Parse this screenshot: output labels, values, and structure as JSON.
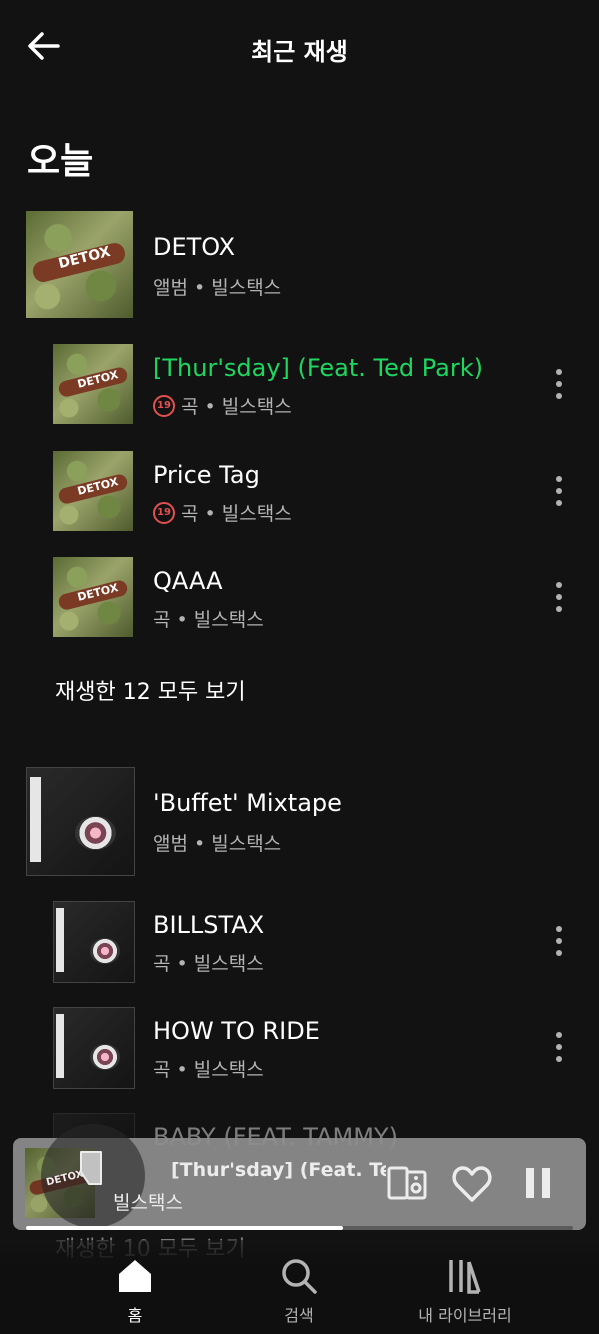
{
  "header": {
    "title": "최근 재생"
  },
  "section": {
    "title": "오늘"
  },
  "group1": {
    "album": {
      "title": "DETOX",
      "subtitle": "앨범 • 빌스택스"
    },
    "tracks": [
      {
        "title": "[Thur'sday] (Feat. Ted Park)",
        "subtitle": "곡 • 빌스택스",
        "explicit": "19",
        "active": true
      },
      {
        "title": "Price Tag",
        "subtitle": "곡 • 빌스택스",
        "explicit": "19"
      },
      {
        "title": "QAAA",
        "subtitle": "곡 • 빌스택스"
      }
    ],
    "see_all": "재생한 12 모두 보기"
  },
  "group2": {
    "album": {
      "title": "'Buffet' Mixtape",
      "subtitle": "앨범 • 빌스택스"
    },
    "tracks": [
      {
        "title": "BILLSTAX",
        "subtitle": "곡 • 빌스택스"
      },
      {
        "title": "HOW TO RIDE",
        "subtitle": "곡 • 빌스택스"
      },
      {
        "title": "BABY (FEAT. TAMMY)",
        "subtitle": ""
      }
    ],
    "see_all": "재생한 10 모두 보기"
  },
  "player": {
    "title": "[Thur'sday] (Feat. Ted Park)",
    "artist": "빌스택스",
    "progress": 0.58
  },
  "nav": {
    "home": "홈",
    "search": "검색",
    "library": "내 라이브러리"
  },
  "colors": {
    "accent": "#1ed760",
    "background": "#121212",
    "explicit": "#e35050"
  }
}
